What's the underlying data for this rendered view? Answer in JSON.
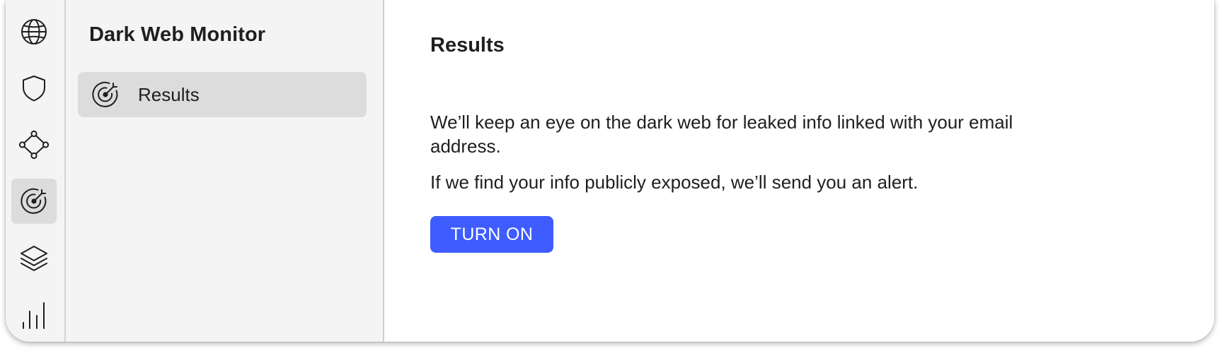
{
  "rail": {
    "items": [
      {
        "icon": "globe-icon",
        "active": false
      },
      {
        "icon": "shield-icon",
        "active": false
      },
      {
        "icon": "network-icon",
        "active": false
      },
      {
        "icon": "radar-target-icon",
        "active": true
      },
      {
        "icon": "layers-icon",
        "active": false
      },
      {
        "icon": "bar-chart-icon",
        "active": false
      }
    ]
  },
  "sidebar": {
    "title": "Dark Web Monitor",
    "items": [
      {
        "label": "Results",
        "icon": "radar-target-icon",
        "selected": true
      }
    ]
  },
  "main": {
    "title": "Results",
    "description_1": "We’ll keep an eye on the dark web for leaked info linked with your email address.",
    "description_2": "If we find your info publicly exposed, we’ll send you an alert.",
    "turn_on_label": "TURN ON"
  },
  "colors": {
    "accent": "#3e5cff",
    "sidebar_bg": "#f4f4f4",
    "selected_bg": "#dcdcdc"
  }
}
